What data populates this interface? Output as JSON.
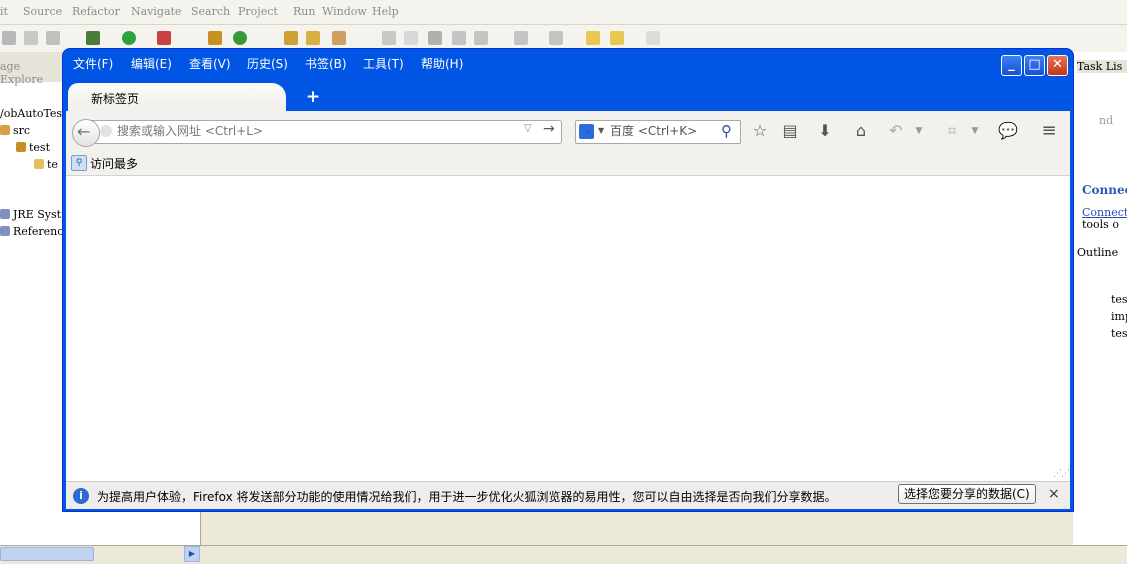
{
  "eclipse": {
    "menu": [
      "it",
      "Source",
      "Refactor",
      "Navigate",
      "Search",
      "Project",
      "Run",
      "Window",
      "Help"
    ],
    "left_panel_title": "age Explore",
    "tree": [
      "/obAutoTest",
      "src",
      "test",
      "te",
      "JRE Syst",
      "Referenc"
    ],
    "right": {
      "task_list": "Task Lis",
      "nd": "nd",
      "connect_title": "Connec",
      "connect_link": "Connect",
      "tools": "tools o",
      "outline": "Outline",
      "outline_items": [
        "tes",
        "imp",
        "tes"
      ]
    }
  },
  "firefox": {
    "menu": [
      "文件(F)",
      "编辑(E)",
      "查看(V)",
      "历史(S)",
      "书签(B)",
      "工具(T)",
      "帮助(H)"
    ],
    "tab_title": "新标签页",
    "new_tab_icon": "+",
    "url_placeholder": "搜索或输入网址 <Ctrl+L>",
    "search_placeholder": "百度 <Ctrl+K>",
    "bookmark_label": "访问最多",
    "notification": {
      "text": "为提高用户体验，Firefox 将发送部分功能的使用情况给我们，用于进一步优化火狐浏览器的易用性，您可以自由选择是否向我们分享数据。",
      "button": "选择您要分享的数据(C)",
      "close": "×"
    }
  }
}
